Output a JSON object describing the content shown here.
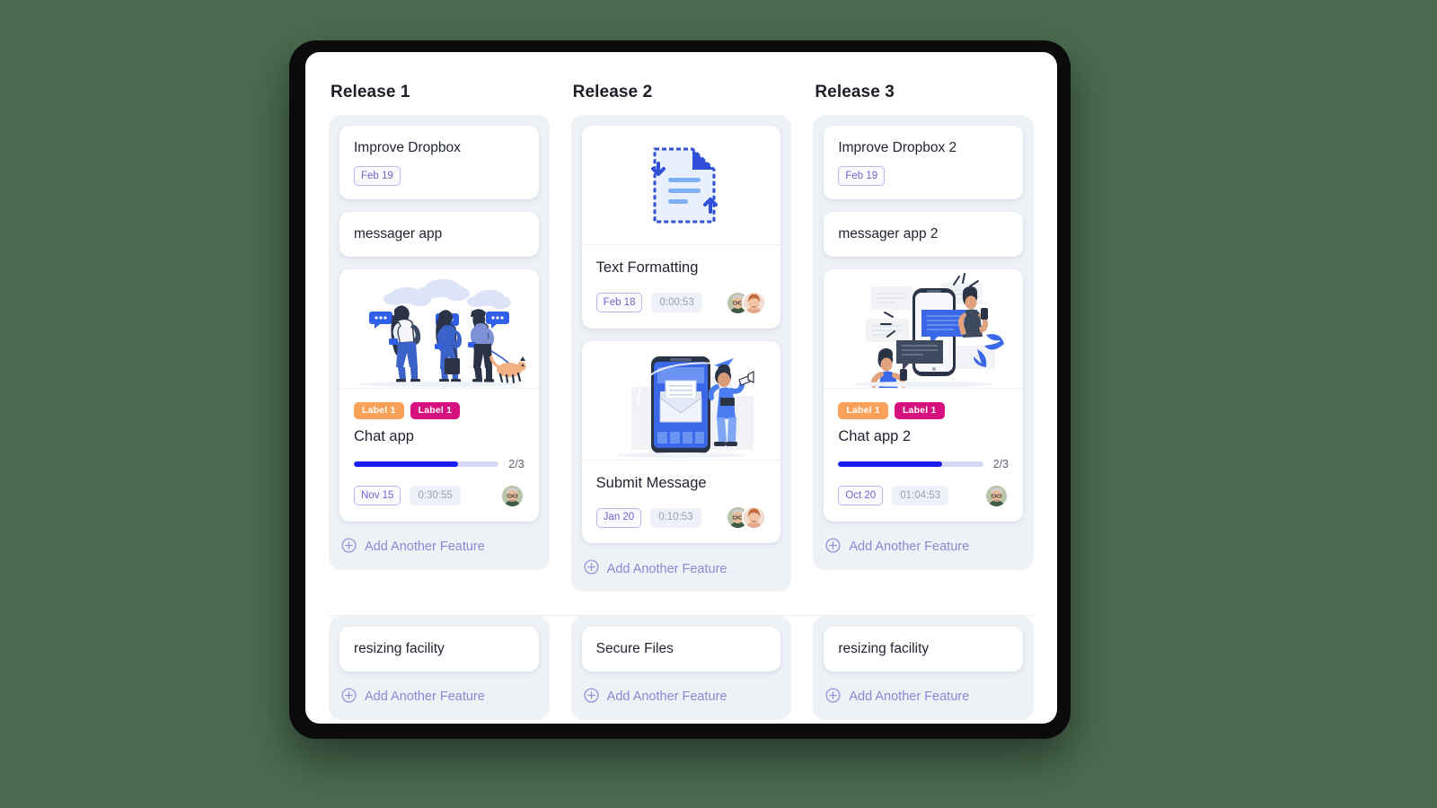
{
  "board": {
    "add_feature_label": "Add Another Feature",
    "columns": [
      {
        "title": "Release 1",
        "cards": [
          {
            "kind": "simple-date",
            "title": "Improve Dropbox",
            "date": "Feb 19"
          },
          {
            "kind": "simple",
            "title": "messager app"
          },
          {
            "kind": "media",
            "illustration": "people-walking-phones",
            "labels": [
              {
                "text": "Label 1",
                "color": "#f9a159"
              },
              {
                "text": "Label 1",
                "color": "#d6117f"
              }
            ],
            "title": "Chat app",
            "progress_ratio": "2/3",
            "progress_percent": 72,
            "date": "Nov 15",
            "time": "0:30:55",
            "avatars": [
              "avatar-man-glasses"
            ]
          }
        ]
      },
      {
        "title": "Release 2",
        "cards": [
          {
            "kind": "media",
            "illustration": "document-arrows",
            "labels": [],
            "title": "Text Formatting",
            "date": "Feb 18",
            "time": "0:00:53",
            "avatars": [
              "avatar-man-glasses",
              "avatar-woman-red-hair"
            ]
          },
          {
            "kind": "media",
            "illustration": "phone-envelope-woman",
            "labels": [],
            "title": "Submit Message",
            "date": "Jan 20",
            "time": "0:10:53",
            "avatars": [
              "avatar-man-glasses",
              "avatar-woman-red-hair"
            ]
          }
        ]
      },
      {
        "title": "Release 3",
        "cards": [
          {
            "kind": "simple-date",
            "title": "Improve Dropbox 2",
            "date": "Feb 19"
          },
          {
            "kind": "simple",
            "title": "messager app 2"
          },
          {
            "kind": "media",
            "illustration": "phone-chat-people",
            "labels": [
              {
                "text": "Label 1",
                "color": "#f9a159"
              },
              {
                "text": "Label 1",
                "color": "#d6117f"
              }
            ],
            "title": "Chat app 2",
            "progress_ratio": "2/3",
            "progress_percent": 72,
            "date": "Oct 20",
            "time": "01:04:53",
            "avatars": [
              "avatar-man-glasses"
            ]
          }
        ]
      }
    ],
    "bottom_columns": [
      {
        "title": "resizing facility"
      },
      {
        "title": "Secure Files"
      },
      {
        "title": "resizing facility"
      }
    ]
  },
  "colors": {
    "page_background": "#4a6b4f",
    "column_background": "#eef2f7",
    "progress_fill": "#1a1df0",
    "progress_track": "#d7d9f6",
    "accent_purple": "#8f86d6",
    "label_orange": "#f9a159",
    "label_magenta": "#d6117f"
  }
}
